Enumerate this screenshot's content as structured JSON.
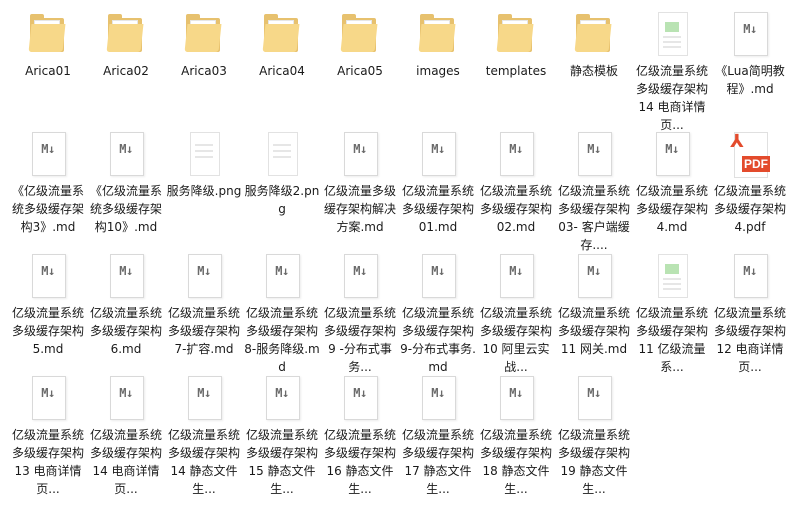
{
  "files": [
    {
      "label": "Arica01",
      "icon": "folder-icon"
    },
    {
      "label": "Arica02",
      "icon": "folder-icon"
    },
    {
      "label": "Arica03",
      "icon": "folder-icon"
    },
    {
      "label": "Arica04",
      "icon": "folder-icon"
    },
    {
      "label": "Arica05",
      "icon": "folder-icon"
    },
    {
      "label": "images",
      "icon": "folder-icon"
    },
    {
      "label": "templates",
      "icon": "folder-icon"
    },
    {
      "label": "静态模板",
      "icon": "folder-icon"
    },
    {
      "label": "亿级流量系统多级缓存架构14 电商详情页...",
      "icon": "document-icon"
    },
    {
      "label": "《Lua简明教程》.md",
      "icon": "markdown-icon"
    },
    {
      "label": "《亿级流量系统多级缓存架构3》.md",
      "icon": "markdown-icon"
    },
    {
      "label": "《亿级流量系统多级缓存架构10》.md",
      "icon": "markdown-icon"
    },
    {
      "label": "服务降级.png",
      "icon": "image-icon"
    },
    {
      "label": "服务降级2.png",
      "icon": "image-icon"
    },
    {
      "label": "亿级流量多级缓存架构解决方案.md",
      "icon": "markdown-icon"
    },
    {
      "label": "亿级流量系统多级缓存架构01.md",
      "icon": "markdown-icon"
    },
    {
      "label": "亿级流量系统多级缓存架构02.md",
      "icon": "markdown-icon"
    },
    {
      "label": "亿级流量系统多级缓存架构03- 客户端缓存....",
      "icon": "markdown-icon"
    },
    {
      "label": "亿级流量系统多级缓存架构4.md",
      "icon": "markdown-icon"
    },
    {
      "label": "亿级流量系统多级缓存架构4.pdf",
      "icon": "pdf-icon"
    },
    {
      "label": "亿级流量系统多级缓存架构5.md",
      "icon": "markdown-icon"
    },
    {
      "label": "亿级流量系统多级缓存架构6.md",
      "icon": "markdown-icon"
    },
    {
      "label": "亿级流量系统多级缓存架构7-扩容.md",
      "icon": "markdown-icon"
    },
    {
      "label": "亿级流量系统多级缓存架构8-服务降级.md",
      "icon": "markdown-icon"
    },
    {
      "label": "亿级流量系统多级缓存架构9 -分布式事务...",
      "icon": "markdown-icon"
    },
    {
      "label": "亿级流量系统多级缓存架构9-分布式事务.md",
      "icon": "markdown-icon"
    },
    {
      "label": "亿级流量系统多级缓存架构10 阿里云实战...",
      "icon": "markdown-icon"
    },
    {
      "label": "亿级流量系统多级缓存架构11 网关.md",
      "icon": "markdown-icon"
    },
    {
      "label": "亿级流量系统多级缓存架构11 亿级流量系...",
      "icon": "document-icon"
    },
    {
      "label": "亿级流量系统多级缓存架构12 电商详情页...",
      "icon": "markdown-icon"
    },
    {
      "label": "亿级流量系统多级缓存架构13 电商详情页...",
      "icon": "markdown-icon"
    },
    {
      "label": "亿级流量系统多级缓存架构14 电商详情页...",
      "icon": "markdown-icon"
    },
    {
      "label": "亿级流量系统多级缓存架构14 静态文件生...",
      "icon": "markdown-icon"
    },
    {
      "label": "亿级流量系统多级缓存架构15 静态文件生...",
      "icon": "markdown-icon"
    },
    {
      "label": "亿级流量系统多级缓存架构16 静态文件生...",
      "icon": "markdown-icon"
    },
    {
      "label": "亿级流量系统多级缓存架构17 静态文件生...",
      "icon": "markdown-icon"
    },
    {
      "label": "亿级流量系统多级缓存架构18 静态文件生...",
      "icon": "markdown-icon"
    },
    {
      "label": "亿级流量系统多级缓存架构19 静态文件生...",
      "icon": "markdown-icon"
    }
  ],
  "icon_text": {
    "markdown": "M↓",
    "pdf_mark": "⅄",
    "pdf_badge": "PDF"
  }
}
